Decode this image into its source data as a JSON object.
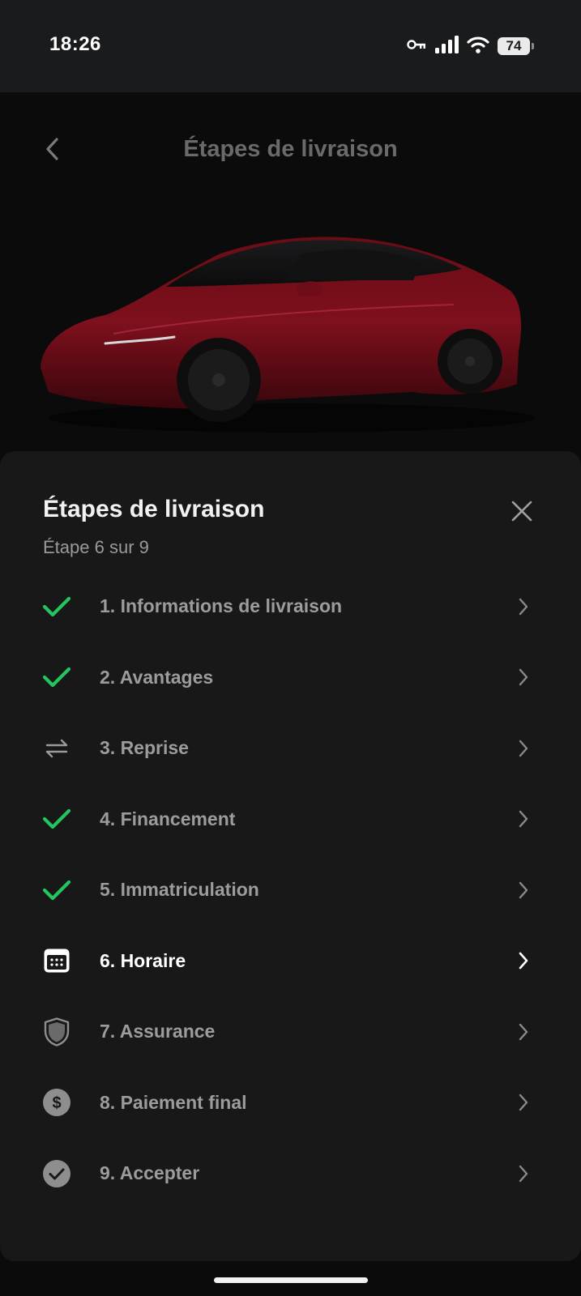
{
  "status_bar": {
    "time": "18:26",
    "battery": "74",
    "icons": [
      "key-icon",
      "signal-icon",
      "wifi-icon",
      "battery-icon"
    ]
  },
  "header": {
    "title": "Étapes de livraison",
    "back_icon": "chevron-left-icon"
  },
  "sheet": {
    "title": "Étapes de livraison",
    "subtitle": "Étape 6 sur 9",
    "close_icon": "close-icon",
    "steps": [
      {
        "label": "1. Informations de livraison",
        "icon": "check-icon",
        "status": "done"
      },
      {
        "label": "2. Avantages",
        "icon": "check-icon",
        "status": "done"
      },
      {
        "label": "3. Reprise",
        "icon": "swap-arrows-icon",
        "status": "skipped"
      },
      {
        "label": "4. Financement",
        "icon": "check-icon",
        "status": "done"
      },
      {
        "label": "5. Immatriculation",
        "icon": "check-icon",
        "status": "done"
      },
      {
        "label": "6. Horaire",
        "icon": "calendar-icon",
        "status": "current"
      },
      {
        "label": "7. Assurance",
        "icon": "shield-icon",
        "status": "todo"
      },
      {
        "label": "8. Paiement final",
        "icon": "dollar-circle-icon",
        "status": "todo"
      },
      {
        "label": "9. Accepter",
        "icon": "check-circle-icon",
        "status": "todo"
      }
    ]
  },
  "colors": {
    "check_green": "#22c55e",
    "sheet_background": "#181819",
    "status_bar_background": "#1a1b1d",
    "car_red": "#8b0f1c"
  }
}
